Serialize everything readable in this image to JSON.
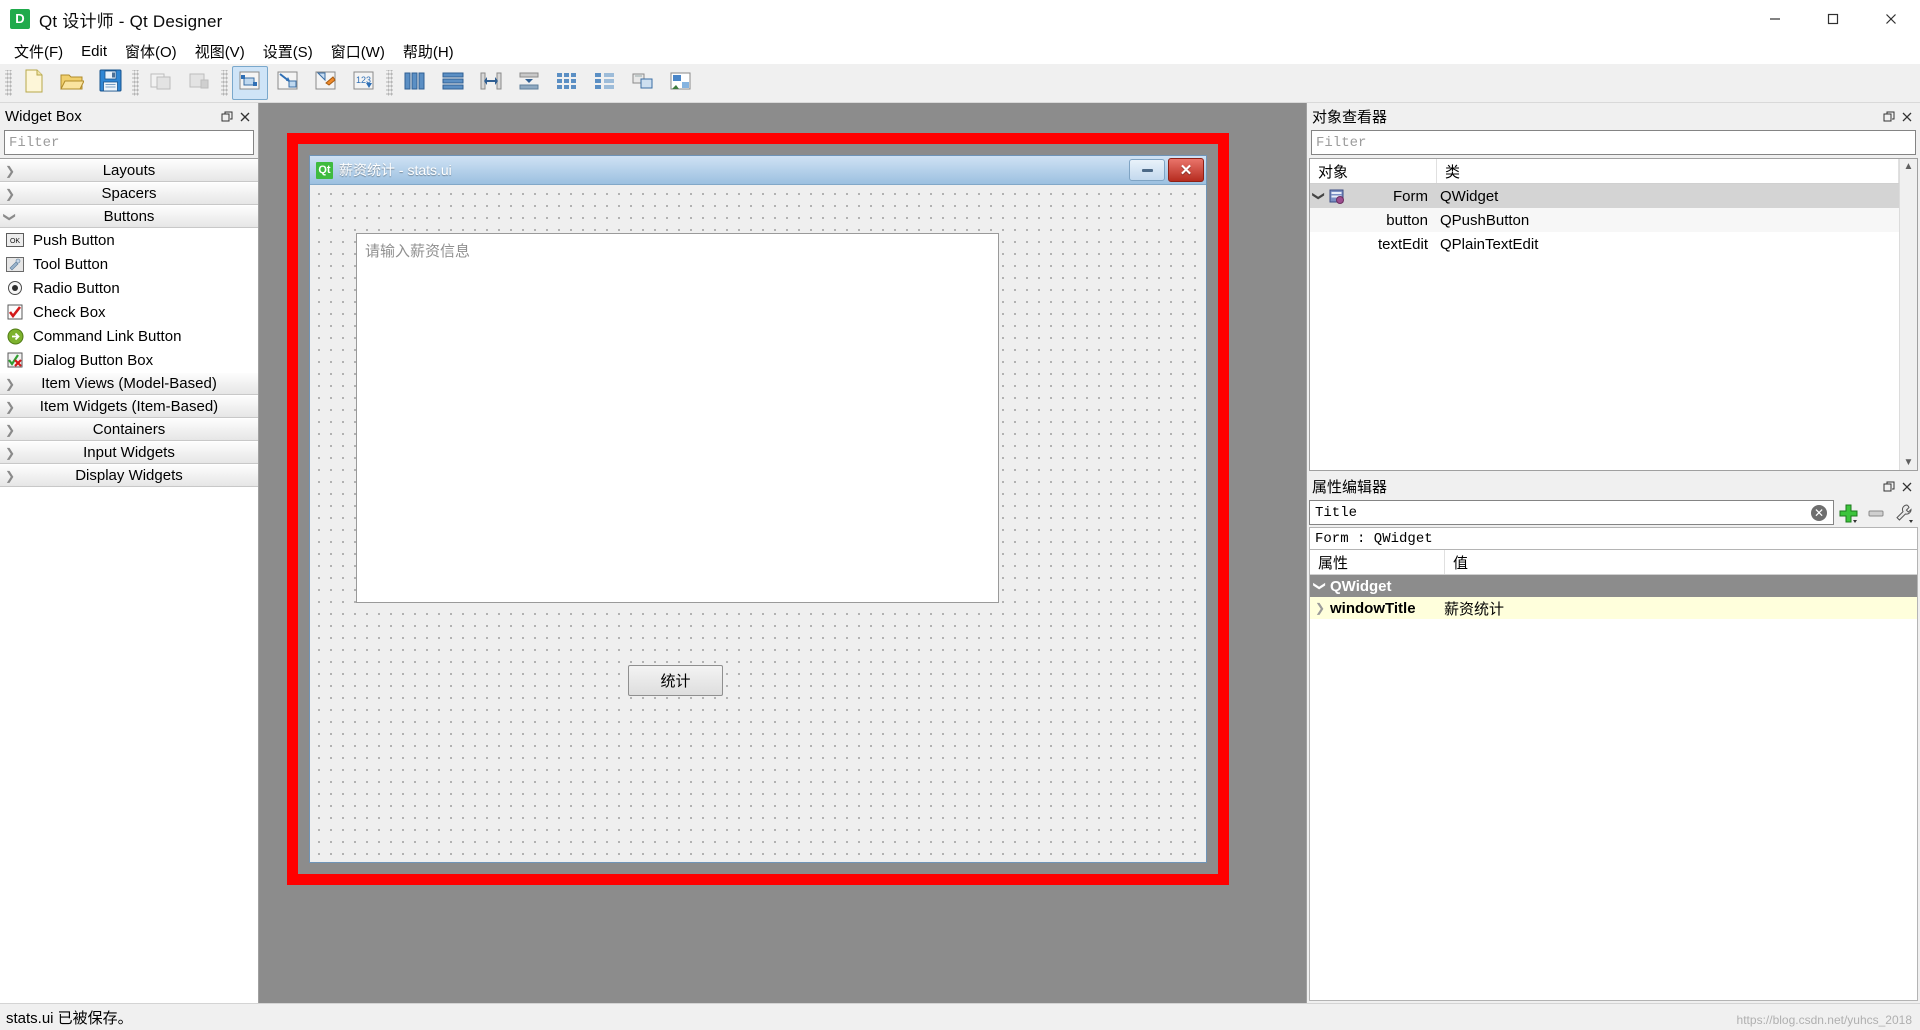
{
  "window": {
    "title": "Qt 设计师 - Qt Designer",
    "app_icon": "qt-designer-icon",
    "minimize_label": "minimize",
    "maximize_label": "maximize",
    "close_label": "close"
  },
  "menubar": {
    "items": [
      {
        "label": "文件(F)",
        "name": "menu-file"
      },
      {
        "label": "Edit",
        "name": "menu-edit"
      },
      {
        "label": "窗体(O)",
        "name": "menu-form"
      },
      {
        "label": "视图(V)",
        "name": "menu-view"
      },
      {
        "label": "设置(S)",
        "name": "menu-settings"
      },
      {
        "label": "窗口(W)",
        "name": "menu-window"
      },
      {
        "label": "帮助(H)",
        "name": "menu-help"
      }
    ]
  },
  "toolbar": {
    "groups": [
      {
        "buttons": [
          {
            "name": "new-form-button",
            "icon": "new-file-icon"
          },
          {
            "name": "open-form-button",
            "icon": "open-folder-icon"
          },
          {
            "name": "save-form-button",
            "icon": "save-disk-icon"
          }
        ]
      },
      {
        "buttons": [
          {
            "name": "undo-button",
            "icon": "undo-icon"
          },
          {
            "name": "redo-button",
            "icon": "redo-icon"
          }
        ]
      },
      {
        "buttons": [
          {
            "name": "edit-widgets-button",
            "icon": "edit-widgets-icon",
            "active": true
          },
          {
            "name": "edit-signals-slots-button",
            "icon": "signals-slots-icon"
          },
          {
            "name": "edit-buddies-button",
            "icon": "buddies-icon"
          },
          {
            "name": "edit-tab-order-button",
            "icon": "tab-order-icon"
          }
        ]
      },
      {
        "buttons": [
          {
            "name": "layout-horizontally-button",
            "icon": "layout-horizontal-icon"
          },
          {
            "name": "layout-vertically-button",
            "icon": "layout-vertical-icon"
          },
          {
            "name": "layout-splitter-horizontal-button",
            "icon": "splitter-horizontal-icon"
          },
          {
            "name": "layout-splitter-vertical-button",
            "icon": "splitter-vertical-icon"
          },
          {
            "name": "layout-grid-button",
            "icon": "layout-grid-icon"
          },
          {
            "name": "layout-form-button",
            "icon": "layout-form-icon"
          },
          {
            "name": "break-layout-button",
            "icon": "break-layout-icon"
          },
          {
            "name": "adjust-size-button",
            "icon": "adjust-size-icon"
          }
        ]
      }
    ]
  },
  "widget_box": {
    "title": "Widget Box",
    "filter_placeholder": "Filter",
    "float_label": "float",
    "close_label": "close",
    "categories": [
      {
        "label": "Layouts",
        "expanded": false,
        "items": []
      },
      {
        "label": "Spacers",
        "expanded": false,
        "items": []
      },
      {
        "label": "Buttons",
        "expanded": true,
        "items": [
          {
            "label": "Push Button",
            "icon": "push-button-icon"
          },
          {
            "label": "Tool Button",
            "icon": "tool-button-icon"
          },
          {
            "label": "Radio Button",
            "icon": "radio-button-icon"
          },
          {
            "label": "Check Box",
            "icon": "check-box-icon"
          },
          {
            "label": "Command Link Button",
            "icon": "command-link-icon"
          },
          {
            "label": "Dialog Button Box",
            "icon": "dialog-button-box-icon"
          }
        ]
      },
      {
        "label": "Item Views (Model-Based)",
        "expanded": false,
        "items": []
      },
      {
        "label": "Item Widgets (Item-Based)",
        "expanded": false,
        "items": []
      },
      {
        "label": "Containers",
        "expanded": false,
        "items": []
      },
      {
        "label": "Input Widgets",
        "expanded": false,
        "items": []
      },
      {
        "label": "Display Widgets",
        "expanded": false,
        "items": []
      }
    ]
  },
  "form": {
    "title": "薪资统计 - stats.ui",
    "icon": "qt-logo-icon",
    "minimize_label": "minimize",
    "close_label": "close",
    "plain_text_edit_placeholder": "请输入薪资信息",
    "button_label": "统计"
  },
  "object_inspector": {
    "title": "对象查看器",
    "filter_placeholder": "Filter",
    "float_label": "float",
    "close_label": "close",
    "columns": [
      "对象",
      "类"
    ],
    "rows": [
      {
        "object": "Form",
        "class": "QWidget",
        "selected": true,
        "depth": 0,
        "icon": "form-node-icon"
      },
      {
        "object": "button",
        "class": "QPushButton",
        "selected": false,
        "depth": 1,
        "icon": ""
      },
      {
        "object": "textEdit",
        "class": "QPlainTextEdit",
        "selected": false,
        "depth": 1,
        "icon": ""
      }
    ]
  },
  "property_editor": {
    "title": "属性编辑器",
    "float_label": "float",
    "close_label": "close",
    "search_value": "Title",
    "clear_label": "clear",
    "add_label": "add",
    "remove_label": "remove",
    "configure_label": "configure",
    "context": "Form : QWidget",
    "columns": [
      "属性",
      "值"
    ],
    "group": "QWidget",
    "rows": [
      {
        "name": "windowTitle",
        "value": "薪资统计"
      }
    ]
  },
  "statusbar": {
    "message": "stats.ui 已被保存。",
    "watermark": "https://blog.csdn.net/yuhcs_2018"
  },
  "colors": {
    "selection_red": "#ff0000",
    "form_titlebar": "#9cc0e0",
    "property_row": "#ffffdc",
    "group_header": "#8c8c8c",
    "canvas": "#8c8c8c"
  }
}
